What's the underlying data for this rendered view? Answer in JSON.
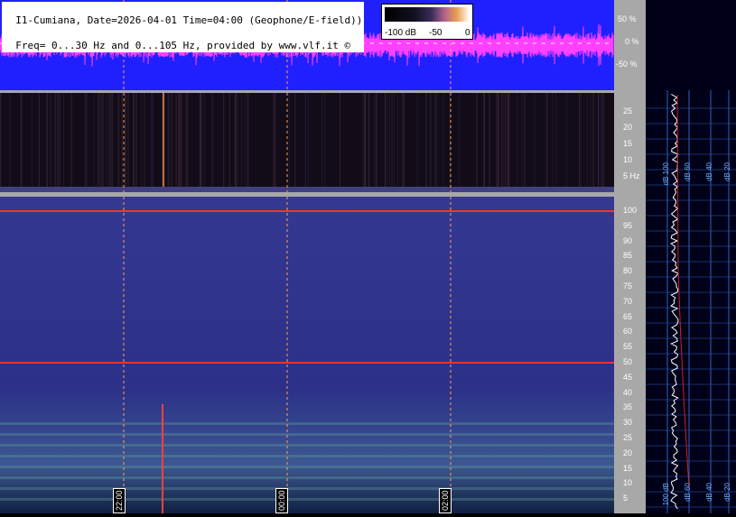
{
  "header": {
    "line1": "I1-Cumiana, Date=2026-04-01 Time=04:00 (Geophone/E-field))",
    "line2": "Freq= 0...30 Hz and 0...105 Hz, provided by www.vlf.it ©"
  },
  "colorbar": {
    "min_label": "-100 dB",
    "mid_label": "-50",
    "max_label": "0"
  },
  "wave_axis": [
    "50 %",
    "0 %",
    "-50 %"
  ],
  "low_axis": [
    "25",
    "20",
    "15",
    "10",
    "5 Hz"
  ],
  "main_axis": [
    "100",
    "95",
    "90",
    "85",
    "80",
    "75",
    "70",
    "65",
    "60",
    "55",
    "50",
    "45",
    "40",
    "35",
    "30",
    "25",
    "20",
    "15",
    "10",
    "5"
  ],
  "time_labels": [
    "22:00",
    "00:00",
    "02:00"
  ],
  "profile_labels_top": [
    "dB 100",
    "dB 60",
    "dB 40",
    "dB 20"
  ],
  "profile_labels_bottom": [
    "100 dB",
    "dB 60",
    "dB 40",
    "dB 20"
  ],
  "colors": {
    "wave_bg": "#2020ff",
    "signal": "#ff40ff",
    "spectrum_bg": "#2c2c80",
    "line": "#ff3030",
    "grid": "#ffa060"
  }
}
